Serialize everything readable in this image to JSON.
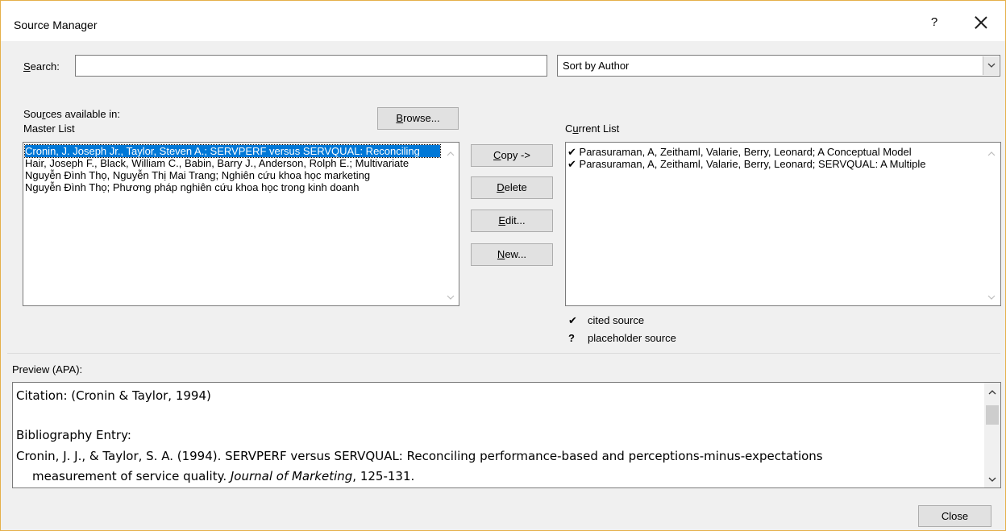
{
  "window": {
    "title": "Source Manager",
    "help": "?"
  },
  "search": {
    "label_pre": "",
    "label_key": "S",
    "label_post": "earch:",
    "value": "",
    "placeholder": ""
  },
  "sort": {
    "selected": "Sort by Author"
  },
  "master": {
    "label_line1_pre": "Sou",
    "label_line1_key": "r",
    "label_line1_post": "ces available in:",
    "label_line2": "Master List",
    "browse_key": "B",
    "browse_rest": "rowse...",
    "items": [
      "Cronin, J. Joseph Jr., Taylor, Steven A.; SERVPERF versus SERVQUAL: Reconciling",
      "Hair, Joseph F., Black, William C., Babin, Barry J., Anderson, Rolph E.; Multivariate",
      "Nguyễn Đình Thọ, Nguyễn Thị Mai Trang; Nghiên cứu khoa học marketing",
      "Nguyễn Đình Thọ; Phương pháp nghiên cứu khoa học trong kinh doanh"
    ]
  },
  "actions": {
    "copy_key": "C",
    "copy_rest": "opy ->",
    "delete_key": "D",
    "delete_rest": "elete",
    "edit_key": "E",
    "edit_rest": "dit...",
    "new_key": "N",
    "new_rest": "ew..."
  },
  "current": {
    "label_pre": "C",
    "label_key": "u",
    "label_post": "rrent List",
    "items": [
      {
        "mark": "✔",
        "text": "Parasuraman, A, Zeithaml, Valarie, Berry, Leonard; A Conceptual Model"
      },
      {
        "mark": "✔",
        "text": "Parasuraman, A, Zeithaml, Valarie, Berry, Leonard; SERVQUAL: A Multiple"
      }
    ]
  },
  "legend": [
    {
      "symbol": "✔",
      "text": "cited source"
    },
    {
      "symbol": "?",
      "text": "placeholder source"
    }
  ],
  "preview": {
    "label": "Preview (APA):",
    "citation": "Citation:  (Cronin & Taylor, 1994)",
    "bib_heading": "Bibliography Entry:",
    "bib_line1": "Cronin, J. J., & Taylor, S. A. (1994). SERVPERF versus SERVQUAL: Reconciling performance-based and perceptions-minus-expectations",
    "bib_line2_pre": "measurement of service quality. ",
    "bib_line2_italic": "Journal of Marketing",
    "bib_line2_post": ", 125-131."
  },
  "footer": {
    "close": "Close"
  }
}
